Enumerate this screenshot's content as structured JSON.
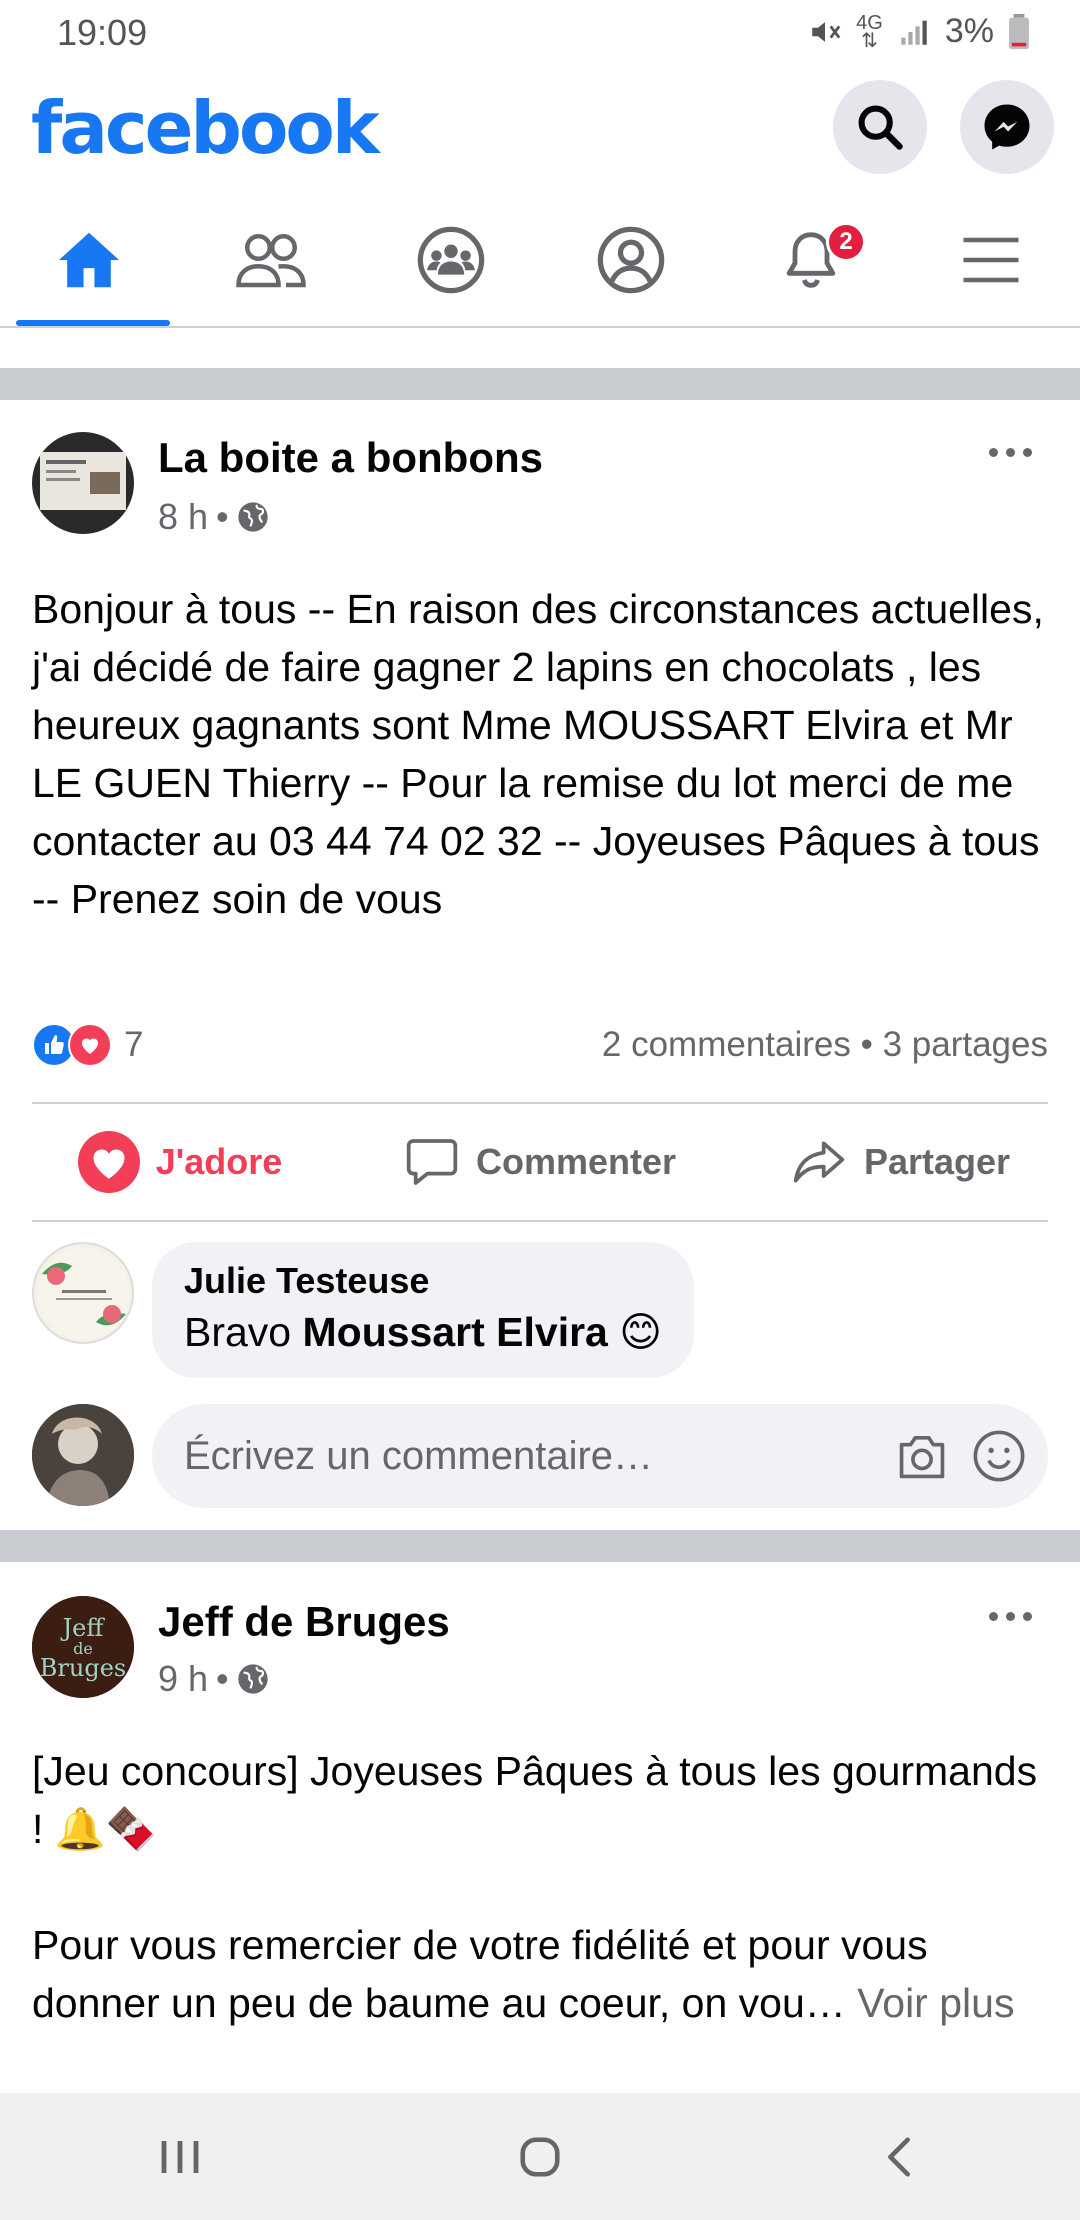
{
  "status_bar": {
    "time": "19:09",
    "network": "4G",
    "battery": "3%"
  },
  "header": {
    "logo": "facebook",
    "search_icon": "search-icon",
    "messenger_icon": "messenger-icon"
  },
  "nav": {
    "tabs": [
      {
        "name": "home",
        "icon": "home-icon",
        "active": true
      },
      {
        "name": "friends",
        "icon": "friends-icon"
      },
      {
        "name": "groups",
        "icon": "groups-icon"
      },
      {
        "name": "profile",
        "icon": "profile-icon"
      },
      {
        "name": "notifications",
        "icon": "bell-icon",
        "badge": "2"
      },
      {
        "name": "menu",
        "icon": "hamburger-icon"
      }
    ]
  },
  "posts": [
    {
      "author": "La boite a bonbons",
      "time": "8 h",
      "visibility_icon": "globe-icon",
      "text": "Bonjour à tous -- En raison des circonstances actuelles, j'ai décidé de faire gagner 2 lapins en chocolats , les heureux gagnants sont Mme MOUSSART Elvira et Mr LE GUEN Thierry -- Pour la remise du lot merci de me contacter au 03 44 74 02 32 -- Joyeuses Pâques à tous -- Prenez soin de vous",
      "reactions_count": "7",
      "comments": "2 commentaires",
      "shares": "3 partages",
      "actions": {
        "love": "J'adore",
        "comment": "Commenter",
        "share": "Partager"
      },
      "comment": {
        "author": "Julie Testeuse",
        "prefix": "Bravo ",
        "mention": "Moussart Elvira",
        "emoji": "😊"
      },
      "comment_placeholder": "Écrivez un commentaire…"
    },
    {
      "author": "Jeff de Bruges",
      "time": "9 h",
      "visibility_icon": "globe-icon",
      "text_line1": "[Jeu concours] Joyeuses Pâques à tous les gourmands ! 🔔🍫",
      "text_line2": "Pour vous remercier de votre fidélité et pour vous donner un peu de baume au coeur, on vou…",
      "see_more": "Voir plus"
    }
  ]
}
